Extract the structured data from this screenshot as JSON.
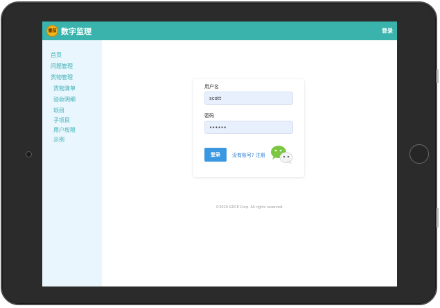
{
  "header": {
    "logo_text": "番茄",
    "title": "数字监理",
    "login_label": "登录"
  },
  "sidebar": {
    "items": [
      {
        "label": "首页"
      },
      {
        "label": "问题管理"
      },
      {
        "label": "货物管理"
      },
      {
        "label": "货物清单"
      },
      {
        "label": "验收明细"
      },
      {
        "label": "项目"
      },
      {
        "label": "子项目"
      },
      {
        "label": "用户权限"
      },
      {
        "label": "示例"
      }
    ]
  },
  "login_form": {
    "username_label": "用户名",
    "username_value": "scott",
    "password_label": "密码",
    "password_value": "123456",
    "submit_label": "登录",
    "register_text": "没有账号? 注册"
  },
  "footer": {
    "copyright": "©2020 GDCE Corp. All rights reserved."
  },
  "colors": {
    "header_bg": "#39b3ac",
    "sidebar_bg": "#e9f6fd",
    "nav_text": "#3bb0b5",
    "primary_button": "#3a97e0",
    "link": "#2a7fd4"
  },
  "icons": {
    "logo": "tomato-logo-icon",
    "wechat": "wechat-icon"
  }
}
